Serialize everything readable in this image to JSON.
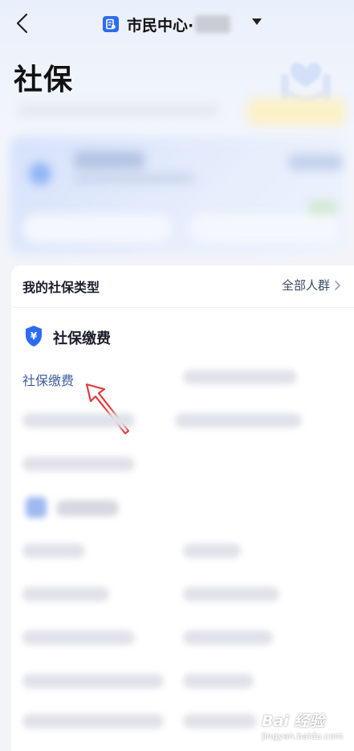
{
  "header": {
    "back_icon": "chevron-left-icon",
    "city_icon": "city-card-icon",
    "title": "市民中心·",
    "dropdown_icon": "caret-down-icon"
  },
  "page": {
    "title": "社保"
  },
  "social_types": {
    "label": "我的社保类型",
    "link": "全部人群"
  },
  "payment_section": {
    "title": "社保缴费",
    "item": "社保缴费"
  },
  "watermark": {
    "text": "Bai 经验",
    "url": "jingyan.baidu.com"
  },
  "colors": {
    "brand_blue": "#2f6bf2",
    "link_blue": "#3f5d9a",
    "arrow_red": "#e03a3e"
  }
}
